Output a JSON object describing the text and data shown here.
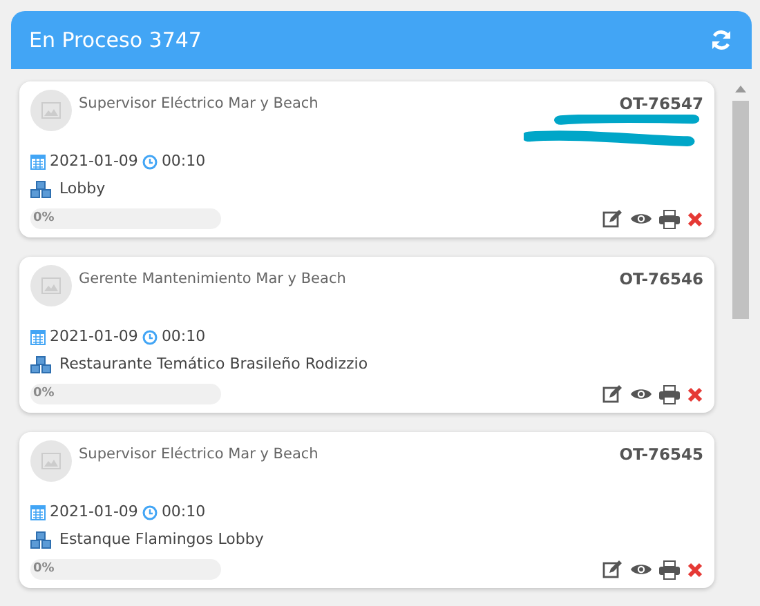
{
  "header": {
    "title": "En Proceso 3747"
  },
  "orders": [
    {
      "role": "Supervisor Eléctrico Mar y Beach",
      "number": "OT-76547",
      "redacted": true,
      "date": "2021-01-09",
      "time": "00:10",
      "location": "Lobby",
      "level": 0,
      "progress_label": "0%"
    },
    {
      "role": "Gerente Mantenimiento Mar y Beach",
      "number": "OT-76546",
      "redacted": false,
      "date": "2021-01-09",
      "time": "00:10",
      "location": "Restaurante Temático Brasileño Rodizzio",
      "level": 0,
      "progress_label": "0%"
    },
    {
      "role": "Supervisor Eléctrico Mar y Beach",
      "number": "OT-76545",
      "redacted": false,
      "date": "2021-01-09",
      "time": "00:10",
      "location": "Estanque Flamingos Lobby",
      "level": 0,
      "progress_label": "0%"
    }
  ]
}
